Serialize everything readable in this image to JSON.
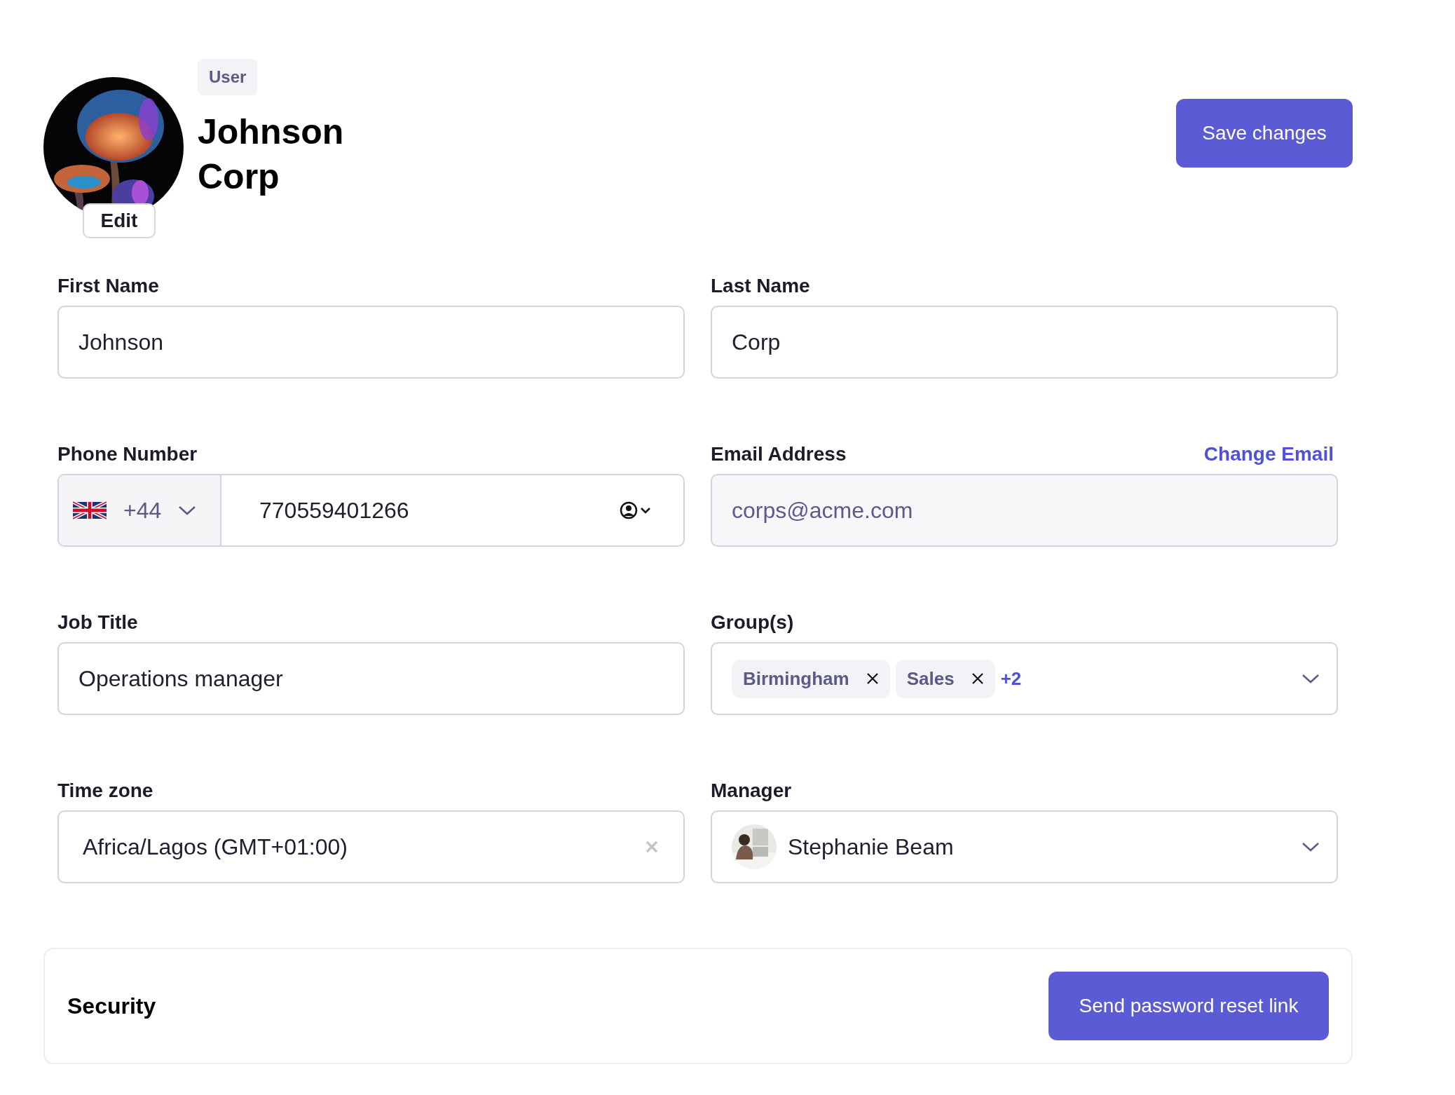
{
  "header": {
    "edit_button": "Edit",
    "badge": "User",
    "name": "Johnson Corp",
    "save_button": "Save changes"
  },
  "fields": [
    {
      "kind": "text",
      "label": "First Name",
      "value": "Johnson",
      "disabled": false
    },
    {
      "kind": "text",
      "label": "Last Name",
      "value": "Corp",
      "disabled": false
    },
    {
      "kind": "phone",
      "label": "Phone Number",
      "country_code": "+44",
      "value": "770559401266",
      "disabled": false
    },
    {
      "kind": "text",
      "label": "Email Address",
      "action": "Change Email",
      "value": "corps@acme.com",
      "disabled": true
    },
    {
      "kind": "text",
      "label": "Job Title",
      "value": "Operations manager",
      "disabled": false
    },
    {
      "kind": "tags",
      "label": "Group(s)",
      "tags": [
        "Birmingham",
        "Sales"
      ],
      "more": "+2",
      "disabled": false
    },
    {
      "kind": "clearable",
      "label": "Time zone",
      "value": "Africa/Lagos (GMT+01:00)",
      "disabled": false
    },
    {
      "kind": "person",
      "label": "Manager",
      "value": "Stephanie Beam",
      "disabled": false
    }
  ],
  "security": {
    "title": "Security",
    "button": "Send password reset link"
  }
}
